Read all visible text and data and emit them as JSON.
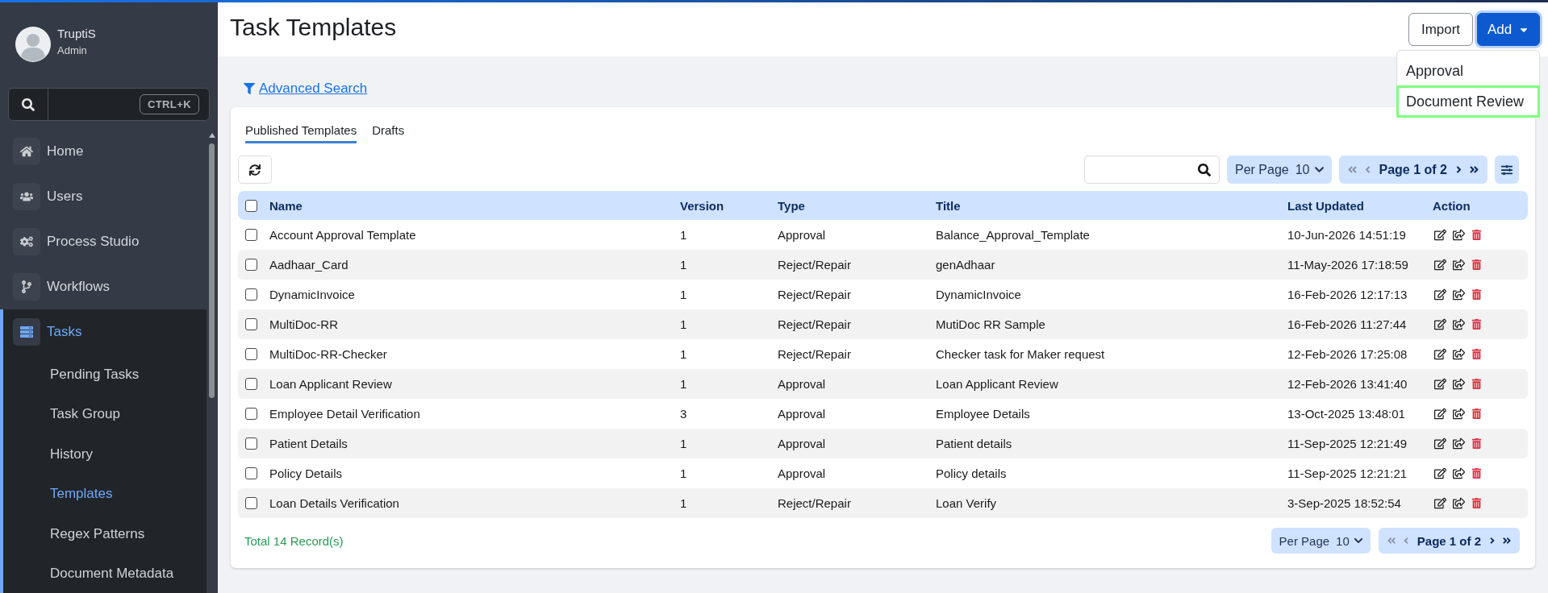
{
  "sidebar": {
    "user": {
      "name": "TruptiS",
      "role": "Admin"
    },
    "search": {
      "shortcut": "CTRL+K"
    },
    "items": [
      {
        "label": "Home",
        "selected": false
      },
      {
        "label": "Users",
        "selected": false
      },
      {
        "label": "Process Studio",
        "selected": false
      },
      {
        "label": "Workflows",
        "selected": false
      },
      {
        "label": "Tasks",
        "selected": true,
        "expanded": true,
        "children": [
          {
            "label": "Pending Tasks",
            "selected": false
          },
          {
            "label": "Task Group",
            "selected": false
          },
          {
            "label": "History",
            "selected": false
          },
          {
            "label": "Templates",
            "selected": true
          },
          {
            "label": "Regex Patterns",
            "selected": false
          },
          {
            "label": "Document Metadata",
            "selected": false
          }
        ]
      }
    ]
  },
  "header": {
    "title": "Task Templates",
    "buttons": [
      {
        "label": "Import",
        "kind": "outline"
      },
      {
        "label": "Add",
        "kind": "dropdown",
        "expanded": true,
        "menu": [
          {
            "label": "Approval",
            "highlighted": false
          },
          {
            "label": "Document Review",
            "highlighted": true
          }
        ]
      }
    ]
  },
  "advanced_search": {
    "label": "Advanced Search"
  },
  "tabs": [
    {
      "label": "Published Templates",
      "selected": true
    },
    {
      "label": "Drafts",
      "selected": false
    }
  ],
  "toolbar": {
    "per_page": {
      "label": "Per Page",
      "value": "10"
    },
    "pagination": {
      "label": "Page 1 of 2",
      "prev_disabled": true,
      "next_disabled": false
    }
  },
  "table": {
    "columns": [
      "Name",
      "Version",
      "Type",
      "Title",
      "Last Updated",
      "Action"
    ],
    "all_checked": false,
    "rows": [
      {
        "name": "Account Approval Template",
        "version": "1",
        "type": "Approval",
        "title": "Balance_Approval_Template",
        "last_updated": "10-Jun-2026 14:51:19",
        "checked": false
      },
      {
        "name": "Aadhaar_Card",
        "version": "1",
        "type": "Reject/Repair",
        "title": "genAdhaar",
        "last_updated": "11-May-2026 17:18:59",
        "checked": false
      },
      {
        "name": "DynamicInvoice",
        "version": "1",
        "type": "Reject/Repair",
        "title": "DynamicInvoice",
        "last_updated": "16-Feb-2026 12:17:13",
        "checked": false
      },
      {
        "name": "MultiDoc-RR",
        "version": "1",
        "type": "Reject/Repair",
        "title": "MutiDoc RR Sample",
        "last_updated": "16-Feb-2026 11:27:44",
        "checked": false
      },
      {
        "name": "MultiDoc-RR-Checker",
        "version": "1",
        "type": "Reject/Repair",
        "title": "Checker task for Maker request",
        "last_updated": "12-Feb-2026 17:25:08",
        "checked": false
      },
      {
        "name": "Loan Applicant Review",
        "version": "1",
        "type": "Approval",
        "title": "Loan Applicant Review",
        "last_updated": "12-Feb-2026 13:41:40",
        "checked": false
      },
      {
        "name": "Employee Detail Verification",
        "version": "3",
        "type": "Approval",
        "title": "Employee Details",
        "last_updated": "13-Oct-2025 13:48:01",
        "checked": false
      },
      {
        "name": "Patient Details",
        "version": "1",
        "type": "Approval",
        "title": "Patient details",
        "last_updated": "11-Sep-2025 12:21:49",
        "checked": false
      },
      {
        "name": "Policy Details",
        "version": "1",
        "type": "Approval",
        "title": "Policy details",
        "last_updated": "11-Sep-2025 12:21:21",
        "checked": false
      },
      {
        "name": "Loan Details Verification",
        "version": "1",
        "type": "Reject/Repair",
        "title": "Loan Verify",
        "last_updated": "3-Sep-2025 18:52:54",
        "checked": false
      }
    ]
  },
  "footer": {
    "total": "Total 14 Record(s)",
    "per_page": {
      "label": "Per Page",
      "value": "10"
    },
    "pagination": {
      "label": "Page 1 of 2",
      "prev_disabled": true,
      "next_disabled": false
    }
  }
}
